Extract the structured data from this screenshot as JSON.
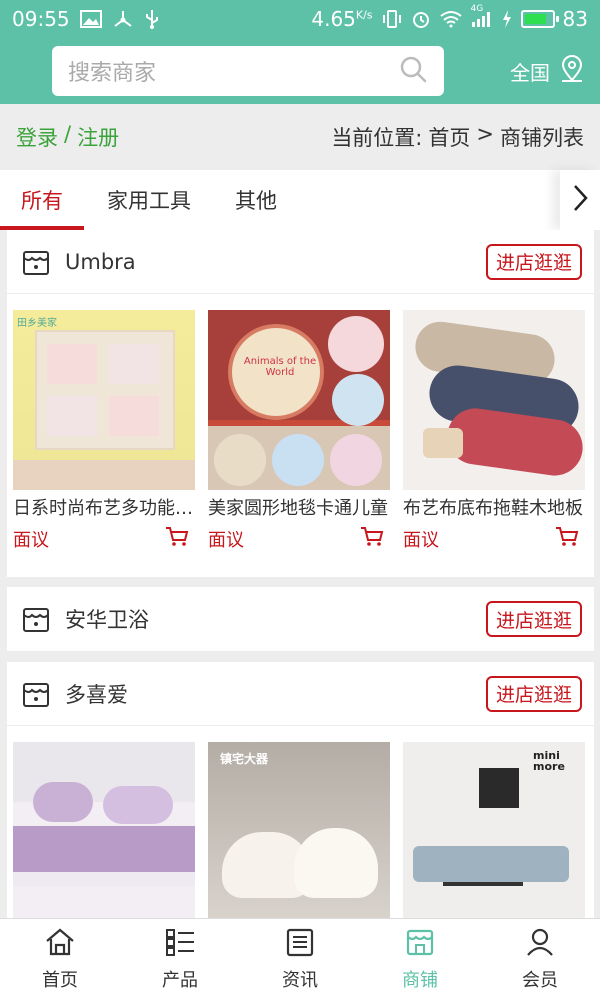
{
  "status_bar": {
    "time": "09:55",
    "speed": "4.65",
    "speed_unit": "K/s",
    "network": "4G",
    "battery": "83",
    "battery_level": 0.83
  },
  "search": {
    "placeholder": "搜索商家",
    "region": "全国"
  },
  "auth": {
    "login": "登录",
    "separator": "/",
    "register": "注册"
  },
  "location": {
    "label": "当前位置:",
    "home": "首页",
    "arrow": ">",
    "current": "商铺列表"
  },
  "tabs": [
    {
      "label": "所有"
    },
    {
      "label": "家用工具"
    },
    {
      "label": "其他"
    }
  ],
  "stores": [
    {
      "name": "Umbra",
      "visit": "进店逛逛",
      "products": [
        {
          "title": "日系时尚布艺多功能挂袋",
          "price": "面议",
          "badge": "田乡美家"
        },
        {
          "title": "美家圆形地毯卡通儿童",
          "price": "面议",
          "badge": "Animals of the World"
        },
        {
          "title": "布艺布底布拖鞋木地板",
          "price": "面议",
          "badge": ""
        }
      ]
    },
    {
      "name": "安华卫浴",
      "visit": "进店逛逛",
      "products": []
    },
    {
      "name": "多喜爱",
      "visit": "进店逛逛",
      "products": [
        {
          "title": "",
          "price": "",
          "badge": ""
        },
        {
          "title": "",
          "price": "",
          "badge": "镇宅大器"
        },
        {
          "title": "",
          "price": "",
          "badge": "mini more"
        }
      ]
    }
  ],
  "bottom_nav": [
    {
      "label": "首页",
      "icon": "home-icon"
    },
    {
      "label": "产品",
      "icon": "product-list-icon"
    },
    {
      "label": "资讯",
      "icon": "news-icon"
    },
    {
      "label": "商铺",
      "icon": "store-icon"
    },
    {
      "label": "会员",
      "icon": "member-icon"
    }
  ],
  "colors": {
    "brand": "#5cc1a6",
    "accent_red": "#c8161d",
    "login_green": "#3aa33a"
  }
}
